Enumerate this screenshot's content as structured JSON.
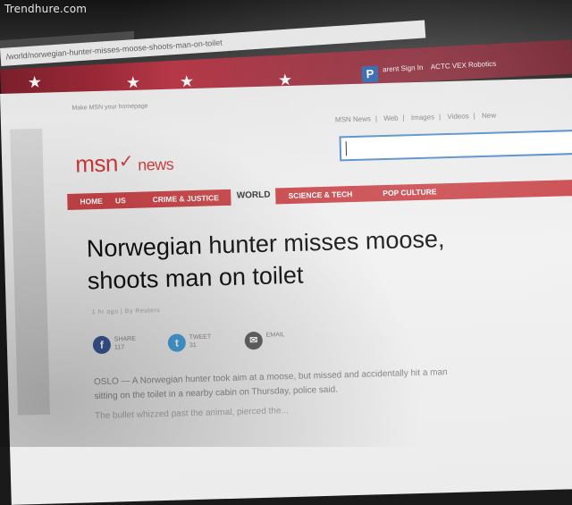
{
  "watermark": "Trendhure.com",
  "browser": {
    "url": "/world/norwegian-hunter-misses-moose-shoots-man-on-toilet",
    "bookmark_p_icon": "P",
    "bookmarks": [
      "arent Sign In",
      "ACTC VEX Robotics"
    ]
  },
  "site": {
    "make_homepage": "Make MSN your homepage",
    "top_links": [
      "MSN News",
      "Web",
      "Images",
      "Videos",
      "New"
    ],
    "logo_msn": "msn",
    "logo_news": "news",
    "nav": [
      "HOME",
      "US",
      "CRIME & JUSTICE",
      "WORLD",
      "SCIENCE & TECH",
      "POP CULTURE"
    ],
    "nav_active": "WORLD"
  },
  "article": {
    "headline_line1": "Norwegian hunter misses moose,",
    "headline_line2": "shoots man on toilet",
    "byline": "1 hr ago | By Reuters",
    "share": [
      {
        "icon": "facebook-icon",
        "glyph": "f",
        "label": "SHARE",
        "count": "117",
        "color": "#3b5998"
      },
      {
        "icon": "twitter-icon",
        "glyph": "t",
        "label": "TWEET",
        "count": "31",
        "color": "#4aa3df"
      },
      {
        "icon": "email-icon",
        "glyph": "✉",
        "label": "EMAIL",
        "count": "",
        "color": "#666666"
      }
    ],
    "body_line1": "OSLO — A Norwegian hunter took aim at a moose, but missed and accidentally hit a man",
    "body_line2": "sitting on the toilet in a nearby cabin on Thursday, police said.",
    "body_line3": "The bullet whizzed past the animal, pierced the..."
  }
}
